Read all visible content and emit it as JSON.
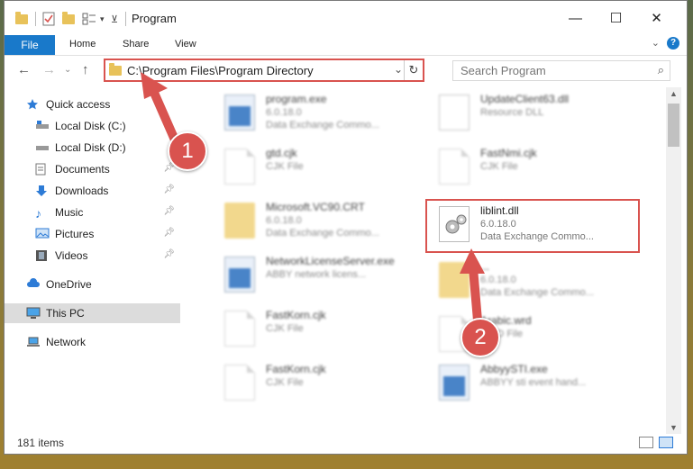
{
  "window": {
    "title": "Program"
  },
  "ribbon": {
    "file_tab": "File",
    "tabs": [
      "Home",
      "Share",
      "View"
    ]
  },
  "navigation": {
    "address": "C:\\Program Files\\Program Directory",
    "search_placeholder": "Search Program"
  },
  "sidebar": {
    "items": [
      {
        "label": "Quick access"
      },
      {
        "label": "Local Disk (C:)"
      },
      {
        "label": "Local Disk (D:)"
      },
      {
        "label": "Documents"
      },
      {
        "label": "Downloads"
      },
      {
        "label": "Music"
      },
      {
        "label": "Pictures"
      },
      {
        "label": "Videos"
      },
      {
        "label": "OneDrive"
      },
      {
        "label": "This PC"
      },
      {
        "label": "Network"
      }
    ]
  },
  "files": {
    "left": [
      {
        "name": "program.exe",
        "line1": "6.0.18.0",
        "line2": "Data Exchange Commo..."
      },
      {
        "name": "gtd.cjk",
        "line1": "CJK File",
        "line2": ""
      },
      {
        "name": "Microsoft.VC90.CRT",
        "line1": "6.0.18.0",
        "line2": "Data Exchange Commo..."
      },
      {
        "name": "NetworkLicenseServer.exe",
        "line1": "ABBY network licens...",
        "line2": ""
      },
      {
        "name": "FastKorn.cjk",
        "line1": "CJK File",
        "line2": ""
      },
      {
        "name": "FastKorn.cjk",
        "line1": "CJK File",
        "line2": ""
      }
    ],
    "right": [
      {
        "name": "UpdateClient63.dll",
        "line1": "Resource DLL",
        "line2": ""
      },
      {
        "name": "FastNmi.cjk",
        "line1": "CJK File",
        "line2": ""
      },
      {
        "name": "liblint.dll",
        "line1": "6.0.18.0",
        "line2": "Data Exchange Commo..."
      },
      {
        "name": "...",
        "line1": "6.0.18.0",
        "line2": "Data Exchange Commo..."
      },
      {
        "name": "Arabic.wrd",
        "line1": "WRD File",
        "line2": ""
      },
      {
        "name": "AbbyySTI.exe",
        "line1": "ABBYY sti event hand...",
        "line2": ""
      }
    ]
  },
  "status": {
    "item_count": "181 items"
  },
  "annotations": {
    "marker1": "1",
    "marker2": "2"
  },
  "colors": {
    "accent": "#1979ca",
    "highlight": "#d9534f",
    "folder": "#e8c25a"
  }
}
